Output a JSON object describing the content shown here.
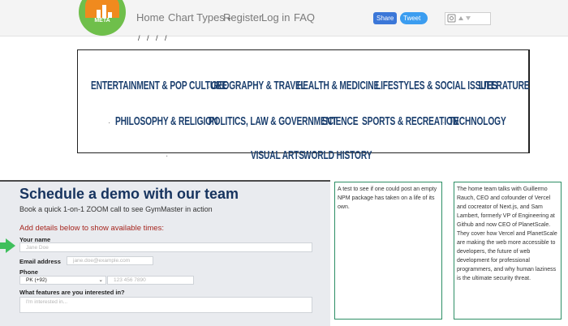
{
  "nav": {
    "logo_text": "META",
    "links": [
      "Home",
      "Chart Types",
      "Register",
      "Log in",
      "FAQ"
    ],
    "chart_types_caret": "▾",
    "share_fb": "Share",
    "share_tw": "Tweet"
  },
  "top_fragment": "/ / / /",
  "categories": {
    "row1": [
      "ENTERTAINMENT & POP CULTURE",
      "GEOGRAPHY & TRAVEL",
      "HEALTH & MEDICINE",
      "LIFESTYLES & SOCIAL ISSUES",
      "LITERATURE"
    ],
    "row2": [
      "PHILOSOPHY & RELIGION",
      "POLITICS, LAW & GOVERNMENT",
      "SCIENCE",
      "SPORTS & RECREATION",
      "TECHNOLOGY"
    ],
    "row3": [
      "VISUAL ARTS",
      "WORLD HISTORY"
    ]
  },
  "demo": {
    "title": "Schedule a demo with our team",
    "subtitle": "Book a quick 1-on-1 ZOOM call to see GymMaster in action",
    "add_details": "Add details below to show available times:",
    "name_label": "Your name",
    "name_placeholder": "Jane Doe",
    "email_label": "Email address",
    "email_placeholder": "jane.doe@example.com",
    "phone_label": "Phone",
    "country_value": "PK (+92)",
    "phone_placeholder": "123 456 7890",
    "features_label": "What features are you interested in?",
    "features_placeholder": "I'm interested in..."
  },
  "cards": [
    {
      "text": "A test to see if one could post an empty NPM package has taken on a life of its own."
    },
    {
      "text": "The home team talks with Guillermo Rauch, CEO and cofounder of Vercel and cocreator of Next.js, and Sam Lambert, formerly VP of Engineering at Github and now CEO of PlanetScale. They cover how Vercel and PlanetScale are making the web more accessible to developers, the future of web development for professional programmers, and why human laziness is the ultimate security threat."
    }
  ],
  "colors": {
    "category_text": "#1b3f6e",
    "demo_title": "#16335e",
    "add_details": "#a6261f",
    "card_border": "#2e8f66",
    "arrow": "#3fbf5c"
  }
}
